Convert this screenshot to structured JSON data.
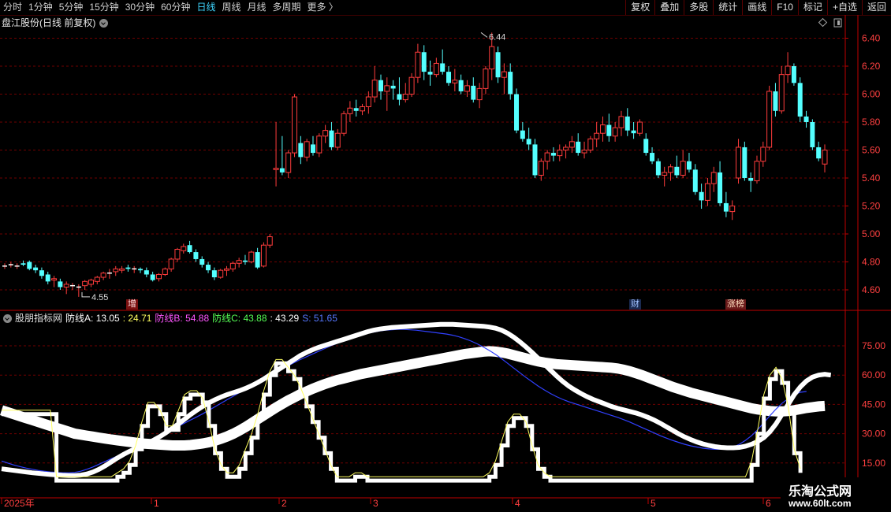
{
  "toolbar": {
    "periods": [
      "分时",
      "1分钟",
      "5分钟",
      "15分钟",
      "30分钟",
      "60分钟",
      "日线",
      "周线",
      "月线",
      "多周期",
      "更多 〉"
    ],
    "active_period": "日线",
    "right_buttons": [
      "复权",
      "叠加",
      "多股",
      "统计",
      "画线",
      "F10",
      "标记",
      "+自选",
      "返回"
    ]
  },
  "main": {
    "title": "盘江股份(日线 前复权)",
    "high_label": "6.44",
    "low_label": "4.55",
    "price_ticks": [
      "6.40",
      "6.20",
      "6.00",
      "5.80",
      "5.60",
      "5.40",
      "5.20",
      "5.00",
      "4.80",
      "4.60"
    ],
    "tags": {
      "zeng": "增",
      "cai": "财",
      "zhangbang": "涨榜"
    }
  },
  "indicator": {
    "source": "股朋指标网",
    "lines": [
      {
        "label": "防线A: 13.05",
        "color": "#ffffff"
      },
      {
        "label": ": 24.71",
        "color": "#ffff60"
      },
      {
        "label": "防线B: 54.88",
        "color": "#ff55ff"
      },
      {
        "label": "防线C: 43.88",
        "color": "#55ff55"
      },
      {
        "label": ": 43.29",
        "color": "#ffffff"
      },
      {
        "label": "S: 51.65",
        "color": "#5577ff"
      }
    ],
    "ticks": [
      "75.00",
      "60.00",
      "45.00",
      "30.00",
      "15.00"
    ]
  },
  "time_axis": {
    "labels": [
      "2025年",
      "1",
      "2",
      "3",
      "4",
      "5",
      "6"
    ]
  },
  "watermark": {
    "site": "乐淘公式网",
    "url": "www.60lt.com"
  },
  "colors": {
    "up": "#ff3c3c",
    "down": "#54ffff",
    "grid": "#700000",
    "axis": "#c00000"
  },
  "chart_data": {
    "type": "candlestick",
    "ylim": [
      4.5,
      6.5
    ],
    "candles": [
      [
        4.77,
        4.79,
        4.75,
        4.77
      ],
      [
        4.78,
        4.8,
        4.76,
        4.78
      ],
      [
        4.77,
        4.79,
        4.75,
        4.77
      ],
      [
        4.79,
        4.81,
        4.77,
        4.78
      ],
      [
        4.8,
        4.81,
        4.74,
        4.75
      ],
      [
        4.76,
        4.78,
        4.72,
        4.74
      ],
      [
        4.74,
        4.76,
        4.68,
        4.7
      ],
      [
        4.71,
        4.73,
        4.64,
        4.66
      ],
      [
        4.67,
        4.7,
        4.62,
        4.68
      ],
      [
        4.66,
        4.68,
        4.6,
        4.62
      ],
      [
        4.62,
        4.66,
        4.57,
        4.64
      ],
      [
        4.63,
        4.65,
        4.6,
        4.63
      ],
      [
        4.62,
        4.64,
        4.55,
        4.62
      ],
      [
        4.63,
        4.67,
        4.6,
        4.66
      ],
      [
        4.64,
        4.68,
        4.62,
        4.67
      ],
      [
        4.66,
        4.7,
        4.64,
        4.69
      ],
      [
        4.69,
        4.73,
        4.67,
        4.72
      ],
      [
        4.72,
        4.75,
        4.68,
        4.72
      ],
      [
        4.73,
        4.77,
        4.7,
        4.75
      ],
      [
        4.74,
        4.77,
        4.72,
        4.75
      ],
      [
        4.76,
        4.78,
        4.73,
        4.75
      ],
      [
        4.75,
        4.77,
        4.72,
        4.75
      ],
      [
        4.75,
        4.76,
        4.72,
        4.74
      ],
      [
        4.74,
        4.76,
        4.69,
        4.71
      ],
      [
        4.71,
        4.73,
        4.66,
        4.67
      ],
      [
        4.68,
        4.72,
        4.66,
        4.71
      ],
      [
        4.71,
        4.76,
        4.7,
        4.75
      ],
      [
        4.75,
        4.83,
        4.73,
        4.82
      ],
      [
        4.82,
        4.9,
        4.8,
        4.89
      ],
      [
        4.88,
        4.93,
        4.86,
        4.91
      ],
      [
        4.92,
        4.95,
        4.86,
        4.87
      ],
      [
        4.87,
        4.89,
        4.8,
        4.82
      ],
      [
        4.82,
        4.84,
        4.76,
        4.78
      ],
      [
        4.78,
        4.8,
        4.72,
        4.74
      ],
      [
        4.74,
        4.76,
        4.67,
        4.69
      ],
      [
        4.69,
        4.75,
        4.68,
        4.74
      ],
      [
        4.74,
        4.77,
        4.7,
        4.75
      ],
      [
        4.75,
        4.8,
        4.73,
        4.79
      ],
      [
        4.79,
        4.83,
        4.76,
        4.81
      ],
      [
        4.81,
        4.85,
        4.78,
        4.8
      ],
      [
        4.8,
        4.88,
        4.79,
        4.87
      ],
      [
        4.87,
        4.9,
        4.75,
        4.76
      ],
      [
        4.77,
        4.94,
        4.76,
        4.92
      ],
      [
        4.92,
        5.0,
        4.9,
        4.98
      ],
      [
        5.46,
        5.8,
        5.34,
        5.47
      ],
      [
        5.47,
        5.7,
        5.42,
        5.44
      ],
      [
        5.44,
        5.6,
        5.4,
        5.58
      ],
      [
        5.58,
        6.0,
        5.55,
        5.98
      ],
      [
        5.65,
        5.7,
        5.5,
        5.55
      ],
      [
        5.55,
        5.68,
        5.52,
        5.66
      ],
      [
        5.64,
        5.7,
        5.56,
        5.58
      ],
      [
        5.58,
        5.72,
        5.55,
        5.7
      ],
      [
        5.7,
        5.78,
        5.65,
        5.74
      ],
      [
        5.74,
        5.8,
        5.6,
        5.62
      ],
      [
        5.62,
        5.75,
        5.6,
        5.72
      ],
      [
        5.72,
        5.88,
        5.7,
        5.86
      ],
      [
        5.86,
        5.95,
        5.8,
        5.9
      ],
      [
        5.9,
        5.96,
        5.84,
        5.88
      ],
      [
        5.88,
        5.93,
        5.85,
        5.91
      ],
      [
        5.91,
        6.02,
        5.86,
        5.98
      ],
      [
        5.98,
        6.2,
        5.94,
        6.1
      ],
      [
        6.1,
        6.14,
        5.96,
        6.02
      ],
      [
        6.02,
        6.12,
        5.88,
        6.06
      ],
      [
        6.06,
        6.1,
        5.96,
        6.04
      ],
      [
        6.0,
        6.12,
        5.92,
        5.96
      ],
      [
        5.96,
        6.08,
        5.94,
        6.0
      ],
      [
        6.0,
        6.15,
        5.98,
        6.12
      ],
      [
        6.12,
        6.36,
        6.08,
        6.3
      ],
      [
        6.3,
        6.35,
        6.1,
        6.16
      ],
      [
        6.16,
        6.24,
        6.06,
        6.14
      ],
      [
        6.14,
        6.26,
        6.12,
        6.22
      ],
      [
        6.22,
        6.32,
        6.14,
        6.16
      ],
      [
        6.16,
        6.2,
        6.06,
        6.08
      ],
      [
        6.08,
        6.18,
        6.02,
        6.1
      ],
      [
        6.1,
        6.14,
        6.0,
        6.02
      ],
      [
        6.02,
        6.1,
        5.98,
        6.06
      ],
      [
        6.06,
        6.12,
        5.94,
        5.96
      ],
      [
        5.96,
        6.08,
        5.9,
        6.04
      ],
      [
        6.04,
        6.2,
        6.0,
        6.18
      ],
      [
        6.18,
        6.44,
        6.1,
        6.34
      ],
      [
        6.3,
        6.34,
        6.08,
        6.12
      ],
      [
        6.12,
        6.22,
        6.0,
        6.16
      ],
      [
        6.16,
        6.22,
        5.96,
        6.0
      ],
      [
        6.0,
        6.04,
        5.72,
        5.74
      ],
      [
        5.74,
        5.8,
        5.66,
        5.68
      ],
      [
        5.68,
        5.76,
        5.6,
        5.64
      ],
      [
        5.64,
        5.68,
        5.4,
        5.42
      ],
      [
        5.42,
        5.54,
        5.38,
        5.52
      ],
      [
        5.52,
        5.6,
        5.46,
        5.58
      ],
      [
        5.58,
        5.62,
        5.52,
        5.56
      ],
      [
        5.56,
        5.64,
        5.52,
        5.6
      ],
      [
        5.6,
        5.64,
        5.54,
        5.62
      ],
      [
        5.62,
        5.7,
        5.58,
        5.66
      ],
      [
        5.66,
        5.72,
        5.56,
        5.58
      ],
      [
        5.58,
        5.66,
        5.54,
        5.6
      ],
      [
        5.6,
        5.7,
        5.58,
        5.68
      ],
      [
        5.68,
        5.8,
        5.62,
        5.72
      ],
      [
        5.72,
        5.84,
        5.66,
        5.78
      ],
      [
        5.78,
        5.86,
        5.66,
        5.7
      ],
      [
        5.7,
        5.8,
        5.66,
        5.76
      ],
      [
        5.76,
        5.88,
        5.7,
        5.84
      ],
      [
        5.84,
        5.9,
        5.7,
        5.74
      ],
      [
        5.74,
        5.8,
        5.68,
        5.72
      ],
      [
        5.72,
        5.82,
        5.7,
        5.8
      ],
      [
        5.68,
        5.72,
        5.56,
        5.58
      ],
      [
        5.58,
        5.62,
        5.5,
        5.52
      ],
      [
        5.52,
        5.54,
        5.4,
        5.42
      ],
      [
        5.42,
        5.48,
        5.34,
        5.44
      ],
      [
        5.44,
        5.5,
        5.38,
        5.48
      ],
      [
        5.48,
        5.56,
        5.4,
        5.42
      ],
      [
        5.42,
        5.6,
        5.4,
        5.52
      ],
      [
        5.52,
        5.58,
        5.44,
        5.46
      ],
      [
        5.46,
        5.5,
        5.28,
        5.3
      ],
      [
        5.3,
        5.36,
        5.18,
        5.24
      ],
      [
        5.24,
        5.4,
        5.2,
        5.36
      ],
      [
        5.36,
        5.48,
        5.3,
        5.44
      ],
      [
        5.44,
        5.52,
        5.2,
        5.22
      ],
      [
        5.22,
        5.3,
        5.12,
        5.16
      ],
      [
        5.16,
        5.24,
        5.1,
        5.2
      ],
      [
        5.4,
        5.68,
        5.36,
        5.62
      ],
      [
        5.62,
        5.66,
        5.38,
        5.4
      ],
      [
        5.4,
        5.44,
        5.3,
        5.38
      ],
      [
        5.38,
        5.56,
        5.36,
        5.52
      ],
      [
        5.52,
        5.66,
        5.48,
        5.62
      ],
      [
        5.62,
        6.06,
        5.6,
        6.02
      ],
      [
        6.02,
        6.08,
        5.84,
        5.88
      ],
      [
        5.88,
        6.2,
        5.86,
        6.14
      ],
      [
        6.14,
        6.3,
        6.08,
        6.2
      ],
      [
        6.2,
        6.22,
        6.06,
        6.08
      ],
      [
        6.08,
        6.12,
        5.8,
        5.84
      ],
      [
        5.84,
        5.88,
        5.76,
        5.8
      ],
      [
        5.8,
        5.82,
        5.6,
        5.62
      ],
      [
        5.62,
        5.66,
        5.52,
        5.54
      ],
      [
        5.5,
        5.64,
        5.44,
        5.6
      ]
    ],
    "indicator_ylim": [
      5,
      90
    ],
    "band_line": [
      42,
      41,
      40,
      39,
      38,
      37,
      36,
      35,
      34,
      33,
      32,
      31,
      30,
      29.5,
      29,
      28.5,
      28,
      27.5,
      27,
      26.6,
      26.2,
      25.8,
      25.4,
      25,
      24.8,
      24.6,
      24.4,
      24.2,
      24,
      24,
      24,
      24.2,
      24.6,
      25,
      25.6,
      26.4,
      27.4,
      28.6,
      30,
      31.6,
      33.4,
      35.4,
      37.4,
      39.4,
      41.4,
      43.4,
      45.2,
      47,
      48.6,
      50.2,
      51.6,
      53,
      54.2,
      55.4,
      56.4,
      57.4,
      58.2,
      59,
      59.8,
      60.6,
      61.2,
      61.8,
      62.4,
      63,
      63.6,
      64.2,
      64.8,
      65.4,
      66,
      66.6,
      67.2,
      67.8,
      68.4,
      69,
      69.6,
      70.2,
      70.8,
      71.2,
      71.6,
      72,
      72.2,
      72,
      71.6,
      71,
      70.2,
      69.4,
      68.6,
      67.8,
      67,
      66.4,
      66,
      65.6,
      65.4,
      65.2,
      65,
      64.8,
      64.6,
      64.4,
      64.2,
      64,
      63.8,
      63.4,
      62.8,
      62,
      61,
      60,
      58.8,
      57.6,
      56.4,
      55.2,
      54,
      53,
      52,
      51,
      50.2,
      49.4,
      48.6,
      47.8,
      47,
      46.2,
      45.4,
      44.6,
      43.8,
      43,
      42.4,
      42,
      41.6,
      41.4,
      41.4,
      41.6,
      42,
      42.6,
      43.2,
      43.6,
      44,
      44.2
    ],
    "envelope_line": [
      12,
      11.6,
      11.2,
      10.8,
      10.4,
      10,
      9.7,
      9.4,
      9.1,
      8.9,
      8.7,
      8.6,
      8.6,
      8.8,
      9.4,
      10.4,
      11.8,
      13.6,
      15.6,
      17.6,
      19.4,
      21,
      22.4,
      23.8,
      25.2,
      26.8,
      28.6,
      30.6,
      32.8,
      35,
      37.4,
      39.8,
      42,
      44,
      45.8,
      47.4,
      48.8,
      50,
      51,
      52,
      53.2,
      54.6,
      56.2,
      58,
      60,
      62,
      64,
      66,
      68,
      70,
      71.6,
      73,
      74.2,
      75.2,
      76.2,
      77.2,
      78.2,
      79.2,
      80.2,
      81.2,
      82.2,
      83,
      83.6,
      84,
      84.4,
      84.6,
      84.8,
      85,
      85.2,
      85.4,
      85.6,
      85.8,
      86,
      86,
      86,
      85.8,
      85.6,
      85.4,
      85.2,
      85,
      84.6,
      84,
      83,
      81.4,
      79.4,
      77,
      74.4,
      71.6,
      68.6,
      65.6,
      62.6,
      59.6,
      56.8,
      54.4,
      52.4,
      50.6,
      49,
      47.6,
      46.4,
      45.2,
      44,
      43,
      42.2,
      41.4,
      40.6,
      39.6,
      38.4,
      37,
      35.4,
      33.6,
      31.8,
      30,
      28.4,
      27,
      25.8,
      24.8,
      24,
      23.4,
      23,
      22.8,
      22.8,
      23,
      23.6,
      24.6,
      26,
      28,
      31,
      35,
      40,
      45,
      50,
      54,
      57,
      59,
      60,
      60.4,
      60
    ],
    "slow_line": [
      16,
      15,
      14,
      13.2,
      12.4,
      11.8,
      11.2,
      10.8,
      10.4,
      10.2,
      10,
      10,
      10.2,
      10.8,
      11.8,
      13,
      14.4,
      15.8,
      17.2,
      18.6,
      20,
      21.4,
      22.8,
      24.2,
      25.8,
      27.4,
      29,
      30.6,
      32.2,
      33.8,
      35.4,
      37,
      38.6,
      40.2,
      42,
      43.8,
      45.6,
      47.4,
      49.2,
      51,
      52.8,
      54.6,
      56.4,
      58.2,
      60,
      61.6,
      63.2,
      64.8,
      66.4,
      68,
      69.4,
      70.8,
      72.2,
      73.6,
      75,
      76.2,
      77.4,
      78.6,
      79.6,
      80.6,
      81.4,
      82,
      82.6,
      83,
      83.2,
      83.4,
      83.4,
      83.2,
      83,
      82.6,
      82.2,
      81.8,
      81.4,
      81,
      80.4,
      79.6,
      78.6,
      77.4,
      76,
      74.4,
      72.6,
      70.6,
      68.4,
      66,
      63.6,
      61.2,
      58.8,
      56.6,
      54.4,
      52.4,
      50.6,
      49,
      47.6,
      46.4,
      45.4,
      44.4,
      43.4,
      42.4,
      41.4,
      40.4,
      39.4,
      38.4,
      37.2,
      36,
      34.6,
      33.2,
      31.8,
      30.4,
      29,
      27.8,
      26.6,
      25.6,
      24.6,
      23.8,
      23.2,
      22.6,
      22.2,
      22,
      22,
      22.4,
      23.2,
      24.6,
      26.6,
      29,
      32,
      35.6,
      39.2,
      42.6,
      45.6,
      48,
      50,
      51.2,
      51.6
    ]
  }
}
